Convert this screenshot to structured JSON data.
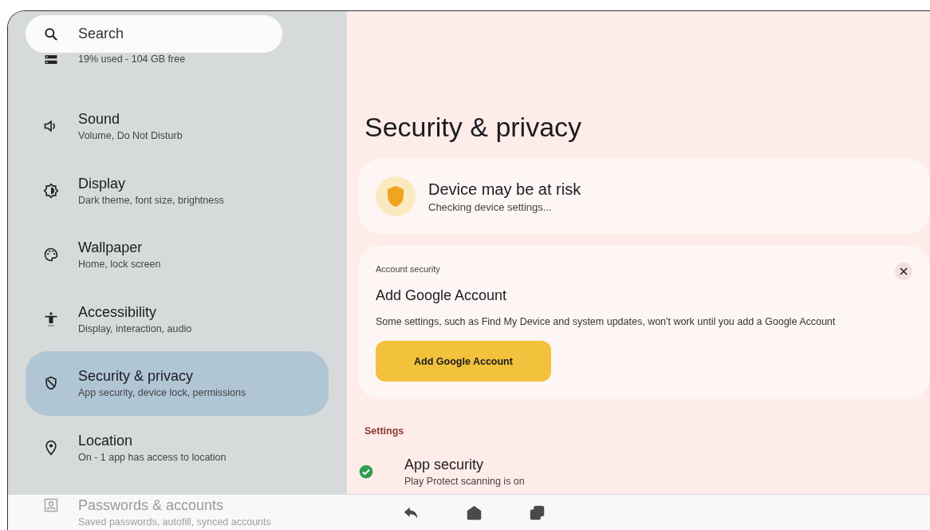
{
  "search": {
    "placeholder": "Search"
  },
  "sidebar": {
    "items": [
      {
        "subtitle": "19% used - 104 GB free",
        "selected": false,
        "dimmed": false
      },
      {
        "title": "Sound",
        "subtitle": "Volume, Do Not Disturb",
        "selected": false,
        "dimmed": false
      },
      {
        "title": "Display",
        "subtitle": "Dark theme, font size, brightness",
        "selected": false,
        "dimmed": false
      },
      {
        "title": "Wallpaper",
        "subtitle": "Home, lock screen",
        "selected": false,
        "dimmed": false
      },
      {
        "title": "Accessibility",
        "subtitle": "Display, interaction, audio",
        "selected": false,
        "dimmed": false
      },
      {
        "title": "Security & privacy",
        "subtitle": "App security, device lock, permissions",
        "selected": true,
        "dimmed": false
      },
      {
        "title": "Location",
        "subtitle": "On - 1 app has access to location",
        "selected": false,
        "dimmed": false
      },
      {
        "title": "Passwords & accounts",
        "subtitle": "Saved passwords, autofill, synced accounts",
        "selected": false,
        "dimmed": true
      }
    ]
  },
  "main": {
    "title": "Security & privacy",
    "status_card": {
      "title": "Device may be at risk",
      "subtitle": "Checking device settings..."
    },
    "account_card": {
      "overline": "Account security",
      "title": "Add Google Account",
      "body": "Some settings, such as Find My Device and system updates, won't work until you add a Google Account",
      "button": "Add Google Account"
    },
    "settings": {
      "header": "Settings",
      "items": [
        {
          "title": "App security",
          "subtitle": "Play Protect scanning is on",
          "kind": "check"
        }
      ]
    }
  },
  "nav_bar": {
    "buttons": [
      {
        "kind": "back"
      },
      {
        "kind": "home"
      },
      {
        "kind": "recents"
      }
    ]
  }
}
